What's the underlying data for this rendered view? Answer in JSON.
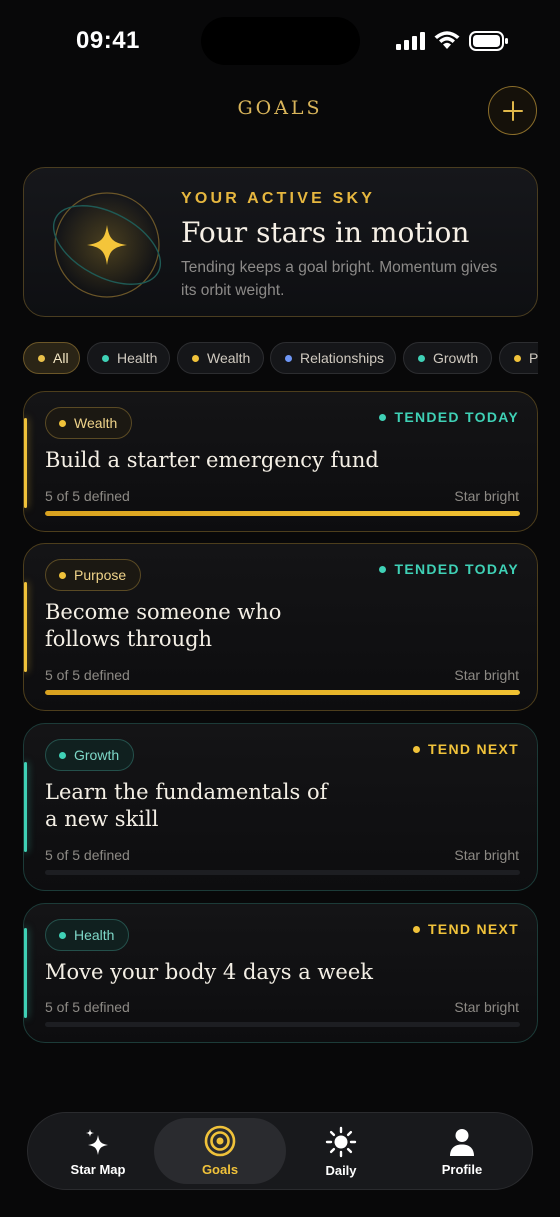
{
  "status_bar": {
    "time": "09:41"
  },
  "header": {
    "title": "GOALS",
    "add_icon": "plus-icon"
  },
  "hero": {
    "eyebrow": "YOUR ACTIVE SKY",
    "title": "Four stars in motion",
    "subtitle": "Tending keeps a goal bright. Momentum gives its orbit weight."
  },
  "filters": [
    {
      "label": "All",
      "color": "#e9c04a",
      "selected": true
    },
    {
      "label": "Health",
      "color": "#3fd1b6"
    },
    {
      "label": "Wealth",
      "color": "#f0c23a"
    },
    {
      "label": "Relationships",
      "color": "#6e96f5"
    },
    {
      "label": "Growth",
      "color": "#3fd1b6"
    },
    {
      "label": "Pu",
      "color": "#f0c23a"
    }
  ],
  "goals": [
    {
      "category": "Wealth",
      "status": "TENDED TODAY",
      "title": "Build a starter emergency fund",
      "defined": "5 of 5 defined",
      "brightness": "Star bright",
      "progress": 1.0,
      "theme": "gold"
    },
    {
      "category": "Purpose",
      "status": "TENDED TODAY",
      "title": "Become someone who follows through",
      "defined": "5 of 5 defined",
      "brightness": "Star bright",
      "progress": 1.0,
      "theme": "gold"
    },
    {
      "category": "Growth",
      "status": "TEND NEXT",
      "title": "Learn the fundamentals of a new skill",
      "defined": "5 of 5 defined",
      "brightness": "Star bright",
      "progress": 0,
      "theme": "teal"
    },
    {
      "category": "Health",
      "status": "TEND NEXT",
      "title": "Move your body 4 days a week",
      "defined": "5 of 5 defined",
      "brightness": "Star bright",
      "progress": 0,
      "theme": "teal"
    }
  ],
  "tabs": [
    {
      "label": "Star Map",
      "icon": "sparkles-icon"
    },
    {
      "label": "Goals",
      "icon": "target-icon",
      "active": true
    },
    {
      "label": "Daily",
      "icon": "sun-icon"
    },
    {
      "label": "Profile",
      "icon": "person-icon"
    }
  ],
  "colors": {
    "gold": "#f0c23a",
    "teal": "#3fd1b6",
    "status_done": "#3fd1b6",
    "status_next": "#f0c23a"
  }
}
